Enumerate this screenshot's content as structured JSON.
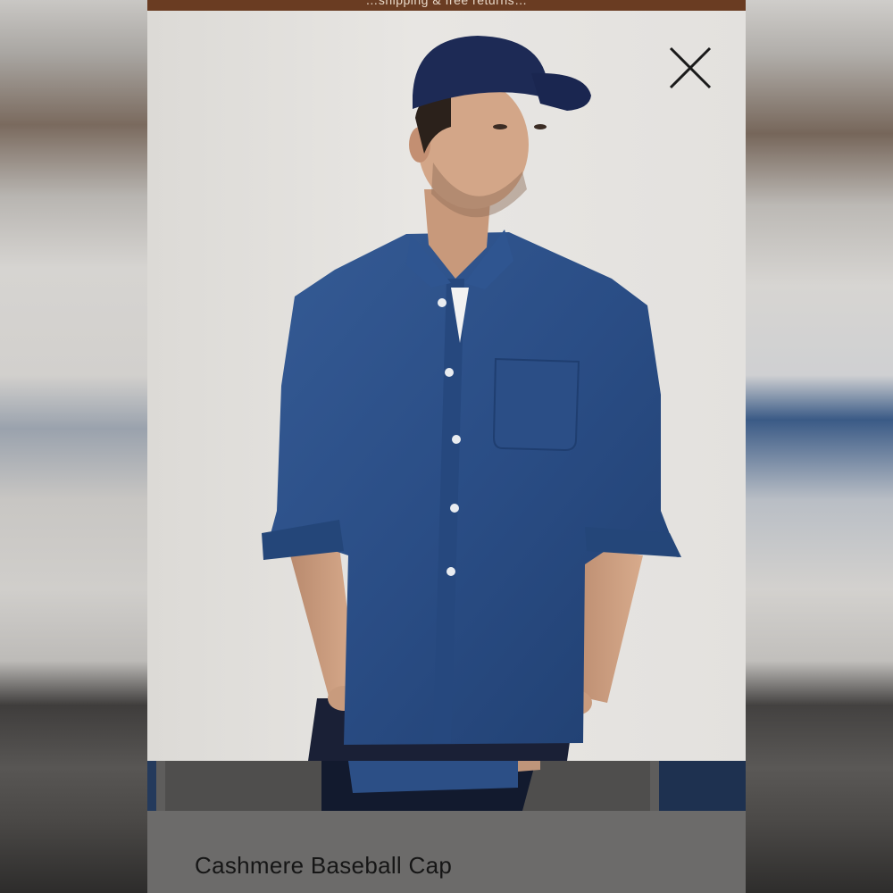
{
  "promo": {
    "text": "…shipping & free returns…"
  },
  "dialog": {
    "close_icon": "close-icon",
    "product_title": "Cashmere Baseball Cap"
  },
  "colors": {
    "promo_bar": "#6a3c22",
    "cap": "#1d2a55",
    "shirt": "#2c4f86",
    "photo_bg": "#e6e4e1",
    "caption_bg": "#6c6b6a"
  }
}
